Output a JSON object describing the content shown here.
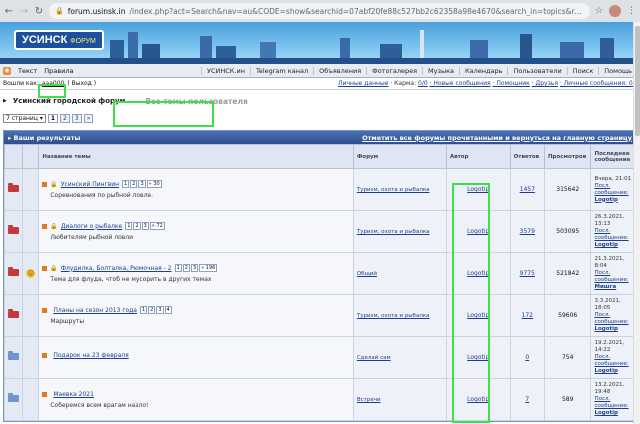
{
  "browser": {
    "url_host": "forum.usinsk.in",
    "url_path": "/index.php?act=Search&nav=au&CODE=show&searchid=07abf20fe88c527bb2c62358a98e4670&search_in=topics&result_type=t..."
  },
  "banner": {
    "logo": "УСИНСК",
    "logo_sub": "ФОРУМ"
  },
  "menu": {
    "left": [
      "Текст",
      "Правила"
    ],
    "items": [
      "УСИНСК.ин",
      "Telegram канал",
      "Объявления",
      "Фотогалерея",
      "Музыка",
      "Календарь",
      "Пользователи",
      "Поиск",
      "Помощь"
    ]
  },
  "userbar": {
    "logged_in_as": "Вошли как:",
    "username": "aaa000",
    "logout": "( Выход )",
    "personal": "Личные данные",
    "karma_label": "· Карма:",
    "karma_value": "0/0",
    "new_messages": "· Новые сообщения",
    "helpers": "· Помощник",
    "friends": "· Друзья",
    "pm": "· Личные сообщения: 0 )"
  },
  "crumb": {
    "forum": "Усинский городской форум",
    "subtitle": "Все темы пользователя"
  },
  "pager": {
    "select": "7 страниц",
    "pages": [
      "1",
      "2",
      "3",
      "»"
    ]
  },
  "results": {
    "title": "Ваши результаты",
    "mark_all": "Отметить все форумы прочитанными и вернуться на главную страницу",
    "columns": {
      "topic": "Название темы",
      "forum": "Форум",
      "author": "Автор",
      "replies": "Ответов",
      "views": "Просмотров",
      "last": "Последнее сообщение"
    },
    "rows": [
      {
        "folder": "red",
        "smile": false,
        "prefix": "🔒",
        "title": "Усинский Пингвин",
        "pages": [
          "1",
          "2",
          "3",
          "» 30"
        ],
        "desc": "Соревнования по рыбной ловле.",
        "forum": "Туризм, охота и рыбалка",
        "author": "Logotip",
        "replies": "1457",
        "views": "315642",
        "last_date": "Вчера, 21:01",
        "last_link": "Посл. сообщение:",
        "last_author": "Logotip"
      },
      {
        "folder": "red",
        "smile": false,
        "prefix": "🔒",
        "title": "Диалоги о рыбалке",
        "pages": [
          "1",
          "2",
          "3",
          "» 72"
        ],
        "desc": "Любителям рыбной ловли",
        "forum": "Туризм, охота и рыбалка",
        "author": "Logotip",
        "replies": "3579",
        "views": "503095",
        "last_date": "26.3.2021, 13:13",
        "last_link": "Посл. сообщение:",
        "last_author": "Logotip"
      },
      {
        "folder": "red",
        "smile": true,
        "prefix": "🔒",
        "title": "Флудилка, Болталка, Рюмочная - 2",
        "pages": [
          "1",
          "2",
          "3",
          "» 196"
        ],
        "desc": "Тема для флуда, чтоб не мусорить в других темах",
        "forum": "Общий",
        "author": "Logotip",
        "replies": "9775",
        "views": "521842",
        "last_date": "21.3.2021, 8:04",
        "last_link": "Посл. сообщение:",
        "last_author": "Мишга"
      },
      {
        "folder": "red",
        "smile": false,
        "prefix": "",
        "title": "Планы на сезон 2013 года",
        "pages": [
          "1",
          "2",
          "3",
          "4"
        ],
        "desc": "Маршруты",
        "forum": "Туризм, охота и рыбалка",
        "author": "Logotip",
        "replies": "172",
        "views": "59606",
        "last_date": "3.3.2021, 18:05",
        "last_link": "Посл. сообщение:",
        "last_author": "Logotip"
      },
      {
        "folder": "blue",
        "smile": false,
        "prefix": "",
        "title": "Подарок на 23 февраля",
        "pages": [],
        "desc": "",
        "forum": "Сделай сам",
        "author": "Logotip",
        "replies": "0",
        "views": "754",
        "last_date": "19.2.2021, 14:22",
        "last_link": "Посл. сообщение:",
        "last_author": "Logotip"
      },
      {
        "folder": "blue",
        "smile": false,
        "prefix": "",
        "title": "Маевка 2021",
        "pages": [],
        "desc": "Соберемся всем врагам назло!",
        "forum": "Встречи",
        "author": "Logotip",
        "replies": "7",
        "views": "589",
        "last_date": "13.2.2021, 19:48",
        "last_link": "Посл. сообщение:",
        "last_author": "Logotip"
      }
    ]
  }
}
